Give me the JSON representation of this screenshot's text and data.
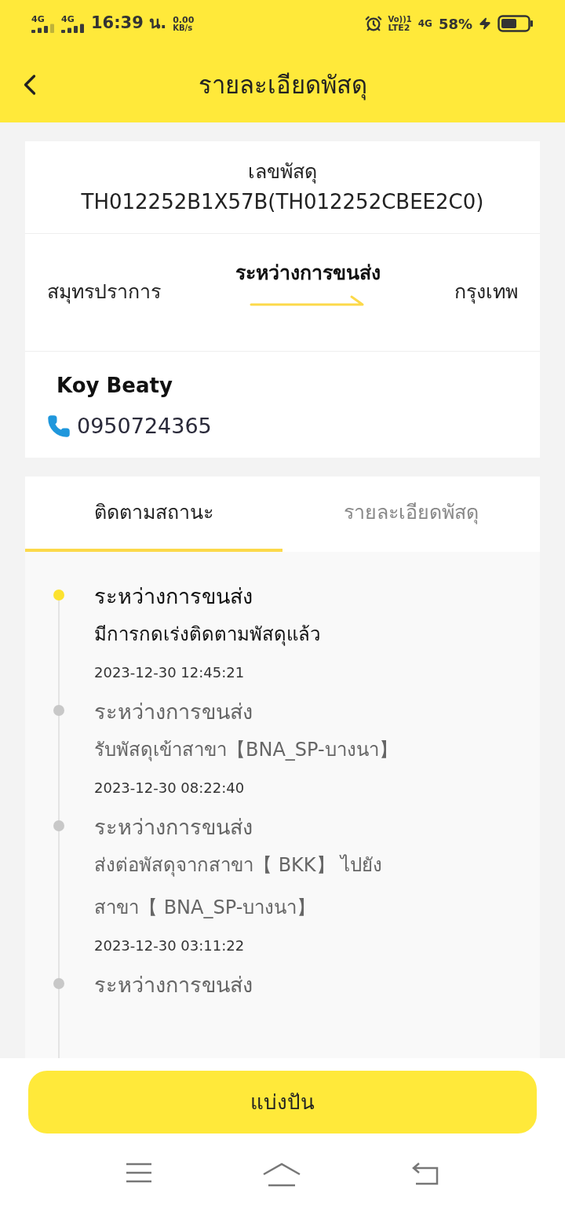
{
  "status_bar": {
    "sim_1": "4G",
    "sim_2": "4G",
    "time": "16:39 น.",
    "speed": "0.00",
    "speed_unit": "KB/s",
    "volte": "Vo))1",
    "lte": "LTE2",
    "network": "4G",
    "battery": "58%"
  },
  "header": {
    "title": "รายละเอียดพัสดุ"
  },
  "parcel": {
    "label": "เลขพัสดุ",
    "number": "TH012252B1X57B(TH012252CBEE2C0)",
    "origin": "สมุทรปราการ",
    "status": "ระหว่างการขนส่ง",
    "destination": "กรุงเทพ",
    "recipient": "Koy Beaty",
    "phone": "0950724365"
  },
  "tabs": [
    {
      "label": "ติดตามสถานะ",
      "selected": true
    },
    {
      "label": "รายละเอียดพัสดุ",
      "selected": false
    }
  ],
  "events": [
    {
      "status": "ระหว่างการขนส่ง",
      "detail": "มีการกดเร่งติดตามพัสดุแล้ว",
      "time": "2023-12-30 12:45:21",
      "current": true
    },
    {
      "status": "ระหว่างการขนส่ง",
      "detail": "รับพัสดุเข้าสาขา【BNA_SP-บางนา】",
      "time": "2023-12-30 08:22:40",
      "current": false
    },
    {
      "status": "ระหว่างการขนส่ง",
      "detail": "ส่งต่อพัสดุจากสาขา【 BKK】 ไปยัง สาขา【 BNA_SP-บางนา】",
      "time": "2023-12-30 03:11:22",
      "current": false
    },
    {
      "status": "ระหว่างการขนส่ง",
      "current": false
    }
  ],
  "share_button": "แบ่งปัน"
}
